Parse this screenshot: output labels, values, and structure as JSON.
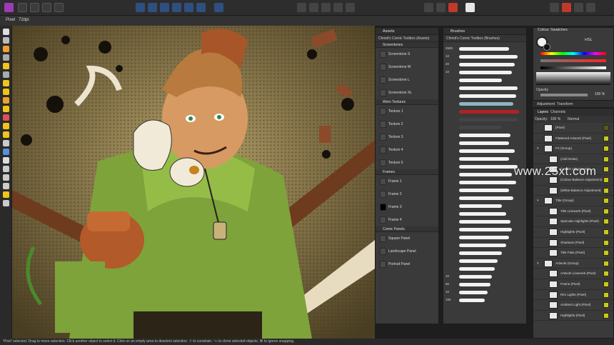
{
  "app": {
    "name": "Affinity Designer"
  },
  "context_bar": {
    "tool_label": "Pixel",
    "dpi_label": "72dpi"
  },
  "status_bar": {
    "text": "'Pixel' selected. Drag to move selection. Click another object to select it. Click on an empty area to deselect selection. ⇧ to constrain. ⌥ to clone selected objects. ⌘ to ignore snapping."
  },
  "assets_panel": {
    "tab_label": "Assets",
    "subheader": "Christi's Comic Toolbox (Assets)",
    "categories": [
      {
        "name": "Screentones",
        "items": [
          "Screentone S",
          "Screentone M",
          "Screentone L",
          "Screentone XL"
        ]
      },
      {
        "name": "Worn Textures",
        "items": [
          "Texture 1",
          "Texture 2",
          "Texture 3",
          "Texture 4",
          "Texture 5"
        ]
      },
      {
        "name": "Frames",
        "items": [
          "Frame 1",
          "Frame 2",
          "Frame 3",
          "Frame 4"
        ]
      },
      {
        "name": "Comic Panels",
        "items": [
          "Square Panel",
          "Landscape Panel",
          "Portrait Panel"
        ]
      }
    ]
  },
  "brushes_panel": {
    "tab_label": "Brushes",
    "subheader": "Christi's Comic Toolbox (Brushes)",
    "sizes": [
      "2500",
      "10",
      "20",
      "10",
      "",
      "",
      "",
      "",
      "",
      "",
      "",
      "",
      "",
      "",
      "",
      "",
      "",
      "",
      "",
      "",
      "",
      "",
      "",
      "",
      "",
      "",
      "",
      "",
      "",
      "10",
      "50",
      "10",
      "150"
    ]
  },
  "colour_panel": {
    "tab_colour": "Colour",
    "tab_swatches": "Swatches",
    "model": "HSL",
    "opacity_label": "Opacity",
    "opacity_value": "100 %"
  },
  "adjustment_tabs": {
    "adjustment": "Adjustment",
    "transform": "Transform"
  },
  "layers_panel": {
    "tab_layers": "Layers",
    "tab_channels": "Channels",
    "opacity_label": "Opacity:",
    "opacity_value": "100 %",
    "blend_mode": "Normal",
    "layers": [
      {
        "name": "(Pixel)",
        "indent": 0,
        "expand": ""
      },
      {
        "name": "Flattened Artwork (Pixel)",
        "indent": 0,
        "expand": ""
      },
      {
        "name": "FX (Group)",
        "indent": 0,
        "expand": "▾"
      },
      {
        "name": "(Add Noise)",
        "indent": 1,
        "expand": ""
      },
      {
        "name": "(Levels Adjustment)",
        "indent": 1,
        "expand": ""
      },
      {
        "name": "(Colour Balance Adjustment)",
        "indent": 1,
        "expand": ""
      },
      {
        "name": "(White Balance Adjustment)",
        "indent": 1,
        "expand": ""
      },
      {
        "name": "Title (Group)",
        "indent": 0,
        "expand": "▾"
      },
      {
        "name": "Title Linework (Pixel)",
        "indent": 1,
        "expand": ""
      },
      {
        "name": "Specular Highlights (Pixel)",
        "indent": 1,
        "expand": ""
      },
      {
        "name": "Highlights (Pixel)",
        "indent": 1,
        "expand": ""
      },
      {
        "name": "Shadows (Pixel)",
        "indent": 1,
        "expand": ""
      },
      {
        "name": "Title Flats (Pixel)",
        "indent": 1,
        "expand": ""
      },
      {
        "name": "Artwork (Group)",
        "indent": 0,
        "expand": "▾"
      },
      {
        "name": "Artwork Linework (Pixel)",
        "indent": 1,
        "expand": ""
      },
      {
        "name": "Frame (Pixel)",
        "indent": 1,
        "expand": ""
      },
      {
        "name": "Rim Lights (Pixel)",
        "indent": 1,
        "expand": ""
      },
      {
        "name": "Ambient Light (Pixel)",
        "indent": 1,
        "expand": ""
      },
      {
        "name": "Highlights (Pixel)",
        "indent": 1,
        "expand": ""
      }
    ]
  },
  "watermark": "www.25xt.com",
  "colors": {
    "accent": "#f0c419",
    "canvas_bg": "#7d6d44",
    "panel_bg": "#3a3a3a",
    "check": "#c8c81e"
  }
}
